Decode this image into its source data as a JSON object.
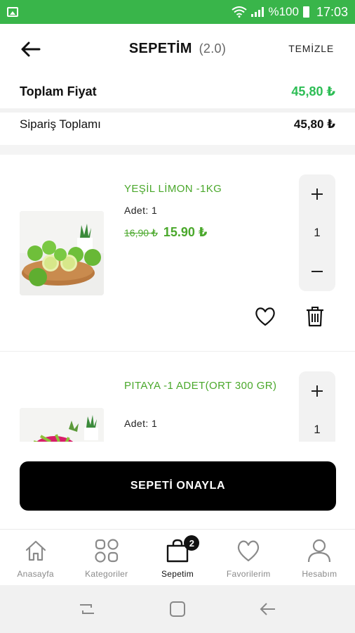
{
  "status_bar": {
    "battery_text": "%100",
    "time": "17:03"
  },
  "header": {
    "title": "SEPETİM",
    "count": "(2.0)",
    "clear_label": "TEMİZLE"
  },
  "totals": {
    "total_price_label": "Toplam Fiyat",
    "total_price_value": "45,80 ₺",
    "order_total_label": "Sipariş Toplamı",
    "order_total_value": "45,80 ₺"
  },
  "cart": {
    "items": [
      {
        "name": "YEŞİL LİMON -1KG",
        "quantity_text": "Adet: 1",
        "old_price": "16,90 ₺",
        "new_price": "15.90 ₺",
        "stepper_value": "1",
        "image_icon": "lime-product-photo"
      },
      {
        "name": "PITAYA -1 ADET(ORT 300 GR)",
        "quantity_text": "Adet: 1",
        "stepper_value": "1",
        "image_icon": "pitaya-product-photo"
      }
    ]
  },
  "confirm_button": {
    "label": "SEPETİ ONAYLA"
  },
  "bottom_nav": {
    "items": [
      {
        "label": "Anasayfa",
        "icon": "home-icon"
      },
      {
        "label": "Kategoriler",
        "icon": "grid-icon"
      },
      {
        "label": "Sepetim",
        "icon": "bag-icon",
        "badge": "2",
        "active": true
      },
      {
        "label": "Favorilerim",
        "icon": "heart-icon"
      },
      {
        "label": "Hesabım",
        "icon": "user-icon"
      }
    ]
  },
  "colors": {
    "status_bar": "#39b54a",
    "accent_green": "#2dbd55",
    "product_green": "#4aa82b",
    "button_black": "#000000"
  }
}
